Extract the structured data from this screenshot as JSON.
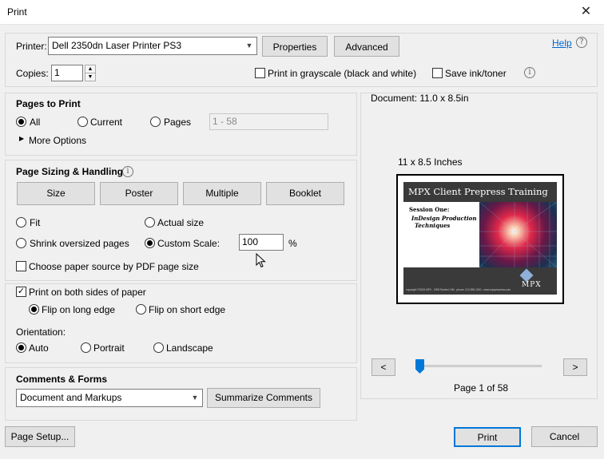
{
  "window": {
    "title": "Print",
    "close_glyph": "✕"
  },
  "printer": {
    "label": "Printer:",
    "selected": "Dell 2350dn Laser Printer PS3",
    "properties_label": "Properties",
    "advanced_label": "Advanced",
    "help_label": "Help"
  },
  "copies": {
    "label": "Copies:",
    "value": "1",
    "grayscale_label": "Print in grayscale (black and white)",
    "save_ink_label": "Save ink/toner"
  },
  "pages_to_print": {
    "heading": "Pages to Print",
    "all_label": "All",
    "current_label": "Current",
    "pages_label": "Pages",
    "pages_value": "1 - 58",
    "more_options_label": "More Options"
  },
  "page_sizing": {
    "heading": "Page Sizing & Handling",
    "tabs": [
      "Size",
      "Poster",
      "Multiple",
      "Booklet"
    ],
    "fit_label": "Fit",
    "actual_size_label": "Actual size",
    "shrink_label": "Shrink oversized pages",
    "custom_scale_label": "Custom Scale:",
    "custom_scale_value": "100",
    "percent_label": "%",
    "paper_source_label": "Choose paper source by PDF page size"
  },
  "duplex": {
    "both_sides_label": "Print on both sides of paper",
    "long_edge_label": "Flip on long edge",
    "short_edge_label": "Flip on short edge"
  },
  "orientation": {
    "heading": "Orientation:",
    "auto_label": "Auto",
    "portrait_label": "Portrait",
    "landscape_label": "Landscape"
  },
  "comments_forms": {
    "heading": "Comments & Forms",
    "selected": "Document and Markups",
    "summarize_label": "Summarize Comments"
  },
  "preview": {
    "document_size": "Document: 11.0 x 8.5in",
    "sheet_size": "11 x 8.5 Inches",
    "slide_title": "MPX Client Prepress Training",
    "slide_session": "Session One:",
    "slide_subtitle_1": "InDesign Production",
    "slide_subtitle_2": "Techniques",
    "slide_logo": "MPX",
    "slide_footer": "copyright ©2005 MPX ∙ 2005 Ruebel, NM ∙ phone: 212.555.1000 ∙ www.mpxprepress.com",
    "prev_label": "<",
    "next_label": ">",
    "page_status": "Page 1 of 58",
    "current_page": 1,
    "total_pages": 58
  },
  "footer": {
    "page_setup_label": "Page Setup...",
    "print_label": "Print",
    "cancel_label": "Cancel"
  },
  "colors": {
    "accent": "#0078d7",
    "link": "#0066cc",
    "slide_bg": "#3a3a3a"
  }
}
